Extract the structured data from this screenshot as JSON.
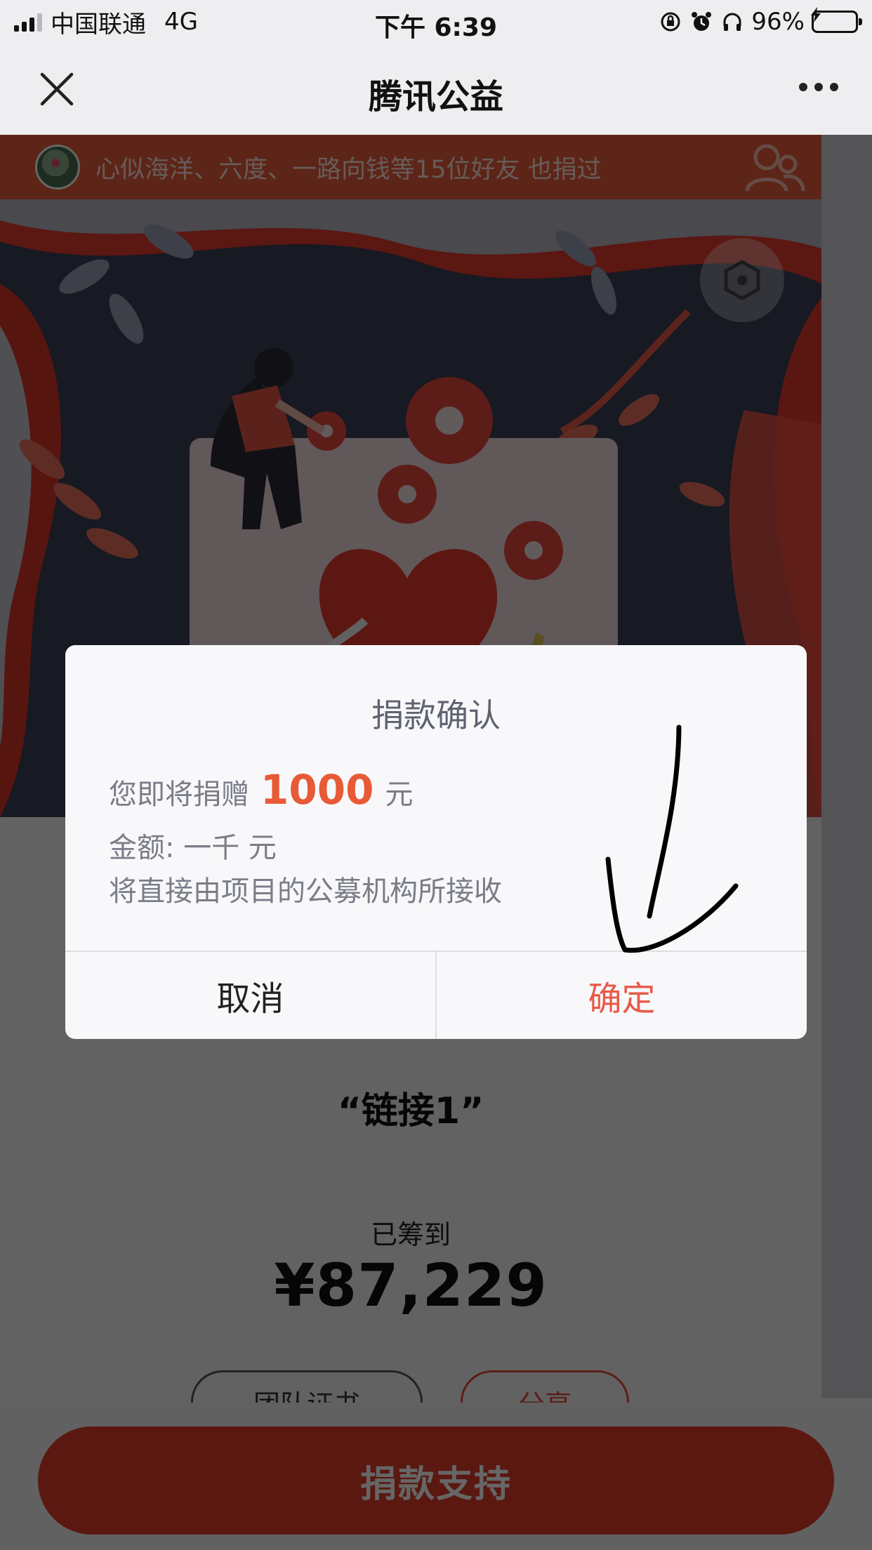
{
  "status_bar": {
    "carrier": "中国联通",
    "network": "4G",
    "time": "下午 6:39",
    "battery": "96%",
    "icons": [
      "signal-icon",
      "orientation-lock-icon",
      "alarm-icon",
      "headphones-icon",
      "battery-charging-icon"
    ]
  },
  "nav": {
    "title": "腾讯公益",
    "close_icon": "close-icon",
    "more_icon": "more-icon"
  },
  "friends_bar": {
    "text": "心似海洋、六度、一路向钱等15位好友 也捐过"
  },
  "project": {
    "name": "“链接1”",
    "raised_label": "已筹到",
    "raised_amount": "¥87,229",
    "team_button": "团队证书",
    "share_button": "分享"
  },
  "bottom": {
    "donate_label": "捐款支持"
  },
  "dialog": {
    "title": "捐款确认",
    "line1_prefix": "您即将捐赠",
    "amount": "1000",
    "line1_suffix": "元",
    "line2": "金额: 一千 元",
    "line3": "将直接由项目的公募机构所接收",
    "cancel_label": "取消",
    "confirm_label": "确定"
  },
  "colors": {
    "accent": "#e85a48",
    "donate_button": "#e23c2c",
    "friends_bar": "#e85d3a",
    "overlay": "rgba(0,0,0,0.6)"
  }
}
